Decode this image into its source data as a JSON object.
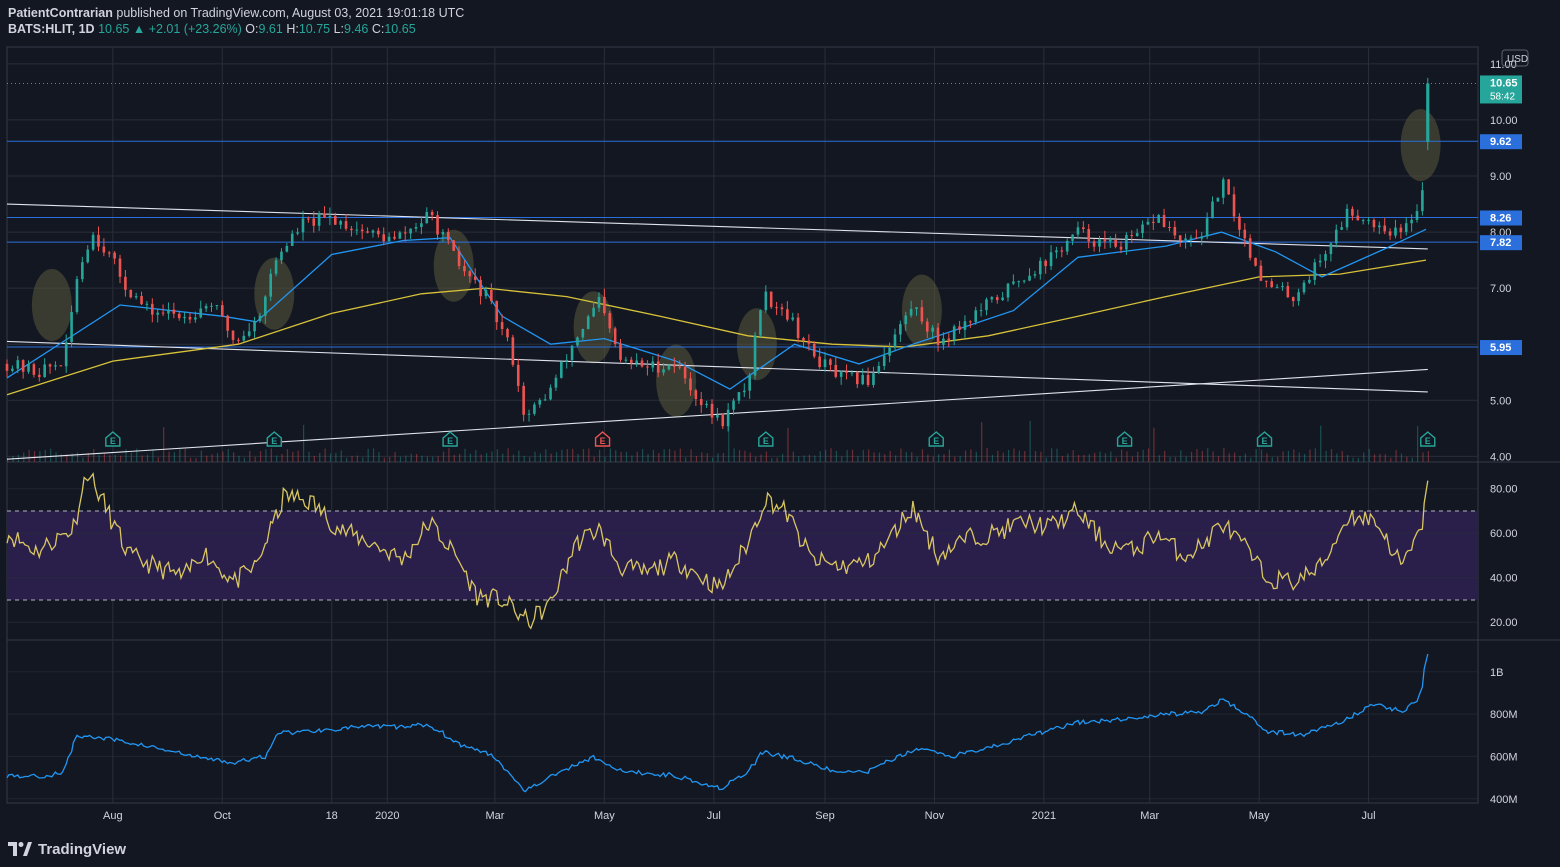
{
  "header": {
    "publisher": "PatientContrarian",
    "published_text": "published on TradingView.com, August 03, 2021 19:01:18 UTC",
    "symbol": "BATS:HLIT, 1D",
    "last": "10.65",
    "change": "+2.01 (+23.26%)",
    "o_label": "O:",
    "o": "9.61",
    "h_label": "H:",
    "h": "10.75",
    "l_label": "L:",
    "l": "9.46",
    "c_label": "C:",
    "c": "10.65"
  },
  "footer": {
    "brand": "TradingView"
  },
  "colors": {
    "background": "#131722",
    "grid": "#2a2e39",
    "up": "#26a69a",
    "down": "#ef5350",
    "ma_fast": "#2196f3",
    "ma_slow": "#d7c23a",
    "rsi": "#d9c663",
    "rsi_band": "#2a1f4a",
    "obv": "#2196f3",
    "level_line": "#2a6fdb",
    "trendline": "#e0e3eb",
    "highlight": "#5a5a3c"
  },
  "chart_data": [
    {
      "type": "candlestick",
      "title": "BATS:HLIT, 1D",
      "currency": "USD",
      "x_tick_labels": [
        "Aug",
        "Oct",
        "18",
        "2020",
        "Mar",
        "May",
        "Jul",
        "Sep",
        "Nov",
        "2021",
        "Mar",
        "May",
        "Jul"
      ],
      "x_tick_dates": [
        "2019-08-01",
        "2019-10-01",
        "2019-12-01",
        "2020-01-01",
        "2020-03-01",
        "2020-05-01",
        "2020-07-01",
        "2020-09-01",
        "2020-11-01",
        "2021-01-01",
        "2021-03-01",
        "2021-05-01",
        "2021-07-01"
      ],
      "x_range": [
        "2019-06-03",
        "2021-08-31"
      ],
      "y_ticks": [
        4.0,
        5.0,
        6.0,
        7.0,
        8.0,
        9.0,
        10.0,
        11.0
      ],
      "y_tick_labels": [
        "4.00",
        "5.00",
        "6.00",
        "7.00",
        "8.00",
        "9.00",
        "10.00",
        "11.00"
      ],
      "ylim": [
        3.9,
        11.3
      ],
      "horizontal_levels": [
        {
          "value": 9.62,
          "label": "9.62"
        },
        {
          "value": 8.26,
          "label": "8.26"
        },
        {
          "value": 7.82,
          "label": "7.82"
        },
        {
          "value": 5.95,
          "label": "5.95"
        }
      ],
      "last_price": {
        "value": 10.65,
        "label": "10.65",
        "countdown": "58:42"
      },
      "price_path": [
        [
          "2019-06-03",
          5.65
        ],
        [
          "2019-06-20",
          5.5
        ],
        [
          "2019-07-05",
          5.7
        ],
        [
          "2019-07-12",
          7.2
        ],
        [
          "2019-07-20",
          8.0
        ],
        [
          "2019-07-28",
          7.7
        ],
        [
          "2019-08-08",
          7.05
        ],
        [
          "2019-08-20",
          6.6
        ],
        [
          "2019-09-10",
          6.5
        ],
        [
          "2019-09-25",
          6.75
        ],
        [
          "2019-10-08",
          6.05
        ],
        [
          "2019-10-20",
          6.4
        ],
        [
          "2019-11-01",
          7.6
        ],
        [
          "2019-11-15",
          8.15
        ],
        [
          "2019-12-01",
          8.25
        ],
        [
          "2019-12-20",
          8.0
        ],
        [
          "2020-01-05",
          7.85
        ],
        [
          "2020-01-25",
          8.3
        ],
        [
          "2020-02-10",
          7.4
        ],
        [
          "2020-02-25",
          6.85
        ],
        [
          "2020-03-10",
          5.9
        ],
        [
          "2020-03-18",
          4.65
        ],
        [
          "2020-04-01",
          5.2
        ],
        [
          "2020-04-15",
          6.1
        ],
        [
          "2020-04-28",
          6.75
        ],
        [
          "2020-05-10",
          5.7
        ],
        [
          "2020-05-25",
          5.6
        ],
        [
          "2020-06-10",
          5.65
        ],
        [
          "2020-06-25",
          4.9
        ],
        [
          "2020-07-05",
          4.6
        ],
        [
          "2020-07-20",
          5.3
        ],
        [
          "2020-07-28",
          6.9
        ],
        [
          "2020-08-10",
          6.6
        ],
        [
          "2020-08-25",
          5.8
        ],
        [
          "2020-09-10",
          5.4
        ],
        [
          "2020-09-25",
          5.35
        ],
        [
          "2020-10-05",
          5.9
        ],
        [
          "2020-10-20",
          6.7
        ],
        [
          "2020-11-03",
          6.05
        ],
        [
          "2020-11-20",
          6.45
        ],
        [
          "2020-12-05",
          6.8
        ],
        [
          "2020-12-20",
          7.2
        ],
        [
          "2021-01-05",
          7.55
        ],
        [
          "2021-01-20",
          8.0
        ],
        [
          "2021-02-05",
          7.75
        ],
        [
          "2021-02-20",
          7.85
        ],
        [
          "2021-03-05",
          8.3
        ],
        [
          "2021-03-20",
          7.75
        ],
        [
          "2021-04-01",
          8.05
        ],
        [
          "2021-04-10",
          8.9
        ],
        [
          "2021-04-25",
          7.7
        ],
        [
          "2021-05-05",
          7.05
        ],
        [
          "2021-05-20",
          6.85
        ],
        [
          "2021-06-05",
          7.55
        ],
        [
          "2021-06-20",
          8.4
        ],
        [
          "2021-07-05",
          8.15
        ],
        [
          "2021-07-20",
          7.95
        ],
        [
          "2021-07-30",
          8.6
        ],
        [
          "2021-08-02",
          9.15
        ],
        [
          "2021-08-03",
          10.65
        ]
      ],
      "last_bar": {
        "date": "2021-08-03",
        "open": 9.61,
        "high": 10.75,
        "low": 9.46,
        "close": 10.65
      },
      "moving_averages": [
        {
          "path": [
            [
              "2019-06-03",
              5.4
            ],
            [
              "2019-08-05",
              6.7
            ],
            [
              "2019-10-01",
              6.5
            ],
            [
              "2019-10-20",
              6.4
            ],
            [
              "2019-12-01",
              7.6
            ],
            [
              "2020-01-10",
              7.85
            ],
            [
              "2020-02-05",
              7.9
            ],
            [
              "2020-03-05",
              6.5
            ],
            [
              "2020-04-01",
              6.0
            ],
            [
              "2020-05-01",
              6.1
            ],
            [
              "2020-06-10",
              5.7
            ],
            [
              "2020-07-10",
              5.2
            ],
            [
              "2020-08-15",
              6.0
            ],
            [
              "2020-09-20",
              5.65
            ],
            [
              "2020-10-20",
              6.0
            ],
            [
              "2020-12-15",
              6.6
            ],
            [
              "2021-01-20",
              7.55
            ],
            [
              "2021-03-10",
              7.75
            ],
            [
              "2021-04-10",
              8.0
            ],
            [
              "2021-05-10",
              7.65
            ],
            [
              "2021-06-05",
              7.2
            ],
            [
              "2021-07-10",
              7.7
            ],
            [
              "2021-08-02",
              8.05
            ]
          ]
        },
        {
          "path": [
            [
              "2019-06-03",
              5.1
            ],
            [
              "2019-08-01",
              5.7
            ],
            [
              "2019-10-10",
              6.0
            ],
            [
              "2019-12-01",
              6.55
            ],
            [
              "2020-01-20",
              6.9
            ],
            [
              "2020-02-25",
              7.0
            ],
            [
              "2020-04-10",
              6.85
            ],
            [
              "2020-06-01",
              6.5
            ],
            [
              "2020-07-20",
              6.15
            ],
            [
              "2020-09-05",
              6.0
            ],
            [
              "2020-10-15",
              5.95
            ],
            [
              "2020-12-01",
              6.15
            ],
            [
              "2021-01-20",
              6.5
            ],
            [
              "2021-03-10",
              6.85
            ],
            [
              "2021-05-01",
              7.2
            ],
            [
              "2021-06-15",
              7.25
            ],
            [
              "2021-08-02",
              7.5
            ]
          ]
        }
      ],
      "trendlines": [
        {
          "from": [
            "2019-06-03",
            8.5
          ],
          "to": [
            "2021-08-03",
            7.7
          ]
        },
        {
          "from": [
            "2019-06-03",
            6.05
          ],
          "to": [
            "2021-08-03",
            5.15
          ]
        },
        {
          "from": [
            "2019-06-03",
            3.95
          ],
          "to": [
            "2021-08-03",
            5.55
          ]
        }
      ],
      "highlights": [
        {
          "date": "2019-06-28",
          "price": 6.7
        },
        {
          "date": "2019-10-30",
          "price": 6.9
        },
        {
          "date": "2020-02-07",
          "price": 7.4
        },
        {
          "date": "2020-04-25",
          "price": 6.3
        },
        {
          "date": "2020-06-10",
          "price": 5.35
        },
        {
          "date": "2020-07-25",
          "price": 6.0
        },
        {
          "date": "2020-10-25",
          "price": 6.6
        },
        {
          "date": "2021-07-30",
          "price": 9.55
        }
      ],
      "earnings_markers": [
        {
          "date": "2019-08-01",
          "label": "E",
          "color": "#26a69a"
        },
        {
          "date": "2019-10-30",
          "label": "E",
          "color": "#26a69a"
        },
        {
          "date": "2020-02-05",
          "label": "E",
          "color": "#26a69a"
        },
        {
          "date": "2020-04-30",
          "label": "E",
          "color": "#ef5350"
        },
        {
          "date": "2020-07-30",
          "label": "E",
          "color": "#26a69a"
        },
        {
          "date": "2020-11-02",
          "label": "E",
          "color": "#26a69a"
        },
        {
          "date": "2021-02-15",
          "label": "E",
          "color": "#26a69a"
        },
        {
          "date": "2021-05-04",
          "label": "E",
          "color": "#26a69a"
        },
        {
          "date": "2021-08-03",
          "label": "E",
          "color": "#26a69a"
        }
      ]
    },
    {
      "type": "line",
      "y_ticks": [
        20,
        40,
        60,
        80
      ],
      "y_tick_labels": [
        "20.00",
        "40.00",
        "60.00",
        "80.00"
      ],
      "ylim": [
        12,
        92
      ],
      "band": [
        30,
        70
      ],
      "path": [
        [
          "2019-06-03",
          60
        ],
        [
          "2019-06-20",
          52
        ],
        [
          "2019-07-10",
          62
        ],
        [
          "2019-07-18",
          88
        ],
        [
          "2019-07-28",
          72
        ],
        [
          "2019-08-10",
          50
        ],
        [
          "2019-08-25",
          45
        ],
        [
          "2019-09-10",
          40
        ],
        [
          "2019-09-20",
          52
        ],
        [
          "2019-10-08",
          38
        ],
        [
          "2019-10-20",
          45
        ],
        [
          "2019-11-05",
          77
        ],
        [
          "2019-11-20",
          74
        ],
        [
          "2019-12-05",
          62
        ],
        [
          "2019-12-25",
          55
        ],
        [
          "2020-01-10",
          48
        ],
        [
          "2020-01-25",
          65
        ],
        [
          "2020-02-10",
          48
        ],
        [
          "2020-02-20",
          32
        ],
        [
          "2020-03-05",
          30
        ],
        [
          "2020-03-20",
          20
        ],
        [
          "2020-04-01",
          28
        ],
        [
          "2020-04-15",
          55
        ],
        [
          "2020-04-28",
          62
        ],
        [
          "2020-05-10",
          45
        ],
        [
          "2020-05-25",
          42
        ],
        [
          "2020-06-10",
          48
        ],
        [
          "2020-06-25",
          40
        ],
        [
          "2020-07-05",
          35
        ],
        [
          "2020-07-20",
          55
        ],
        [
          "2020-07-30",
          76
        ],
        [
          "2020-08-10",
          70
        ],
        [
          "2020-08-25",
          48
        ],
        [
          "2020-09-10",
          45
        ],
        [
          "2020-09-25",
          47
        ],
        [
          "2020-10-05",
          55
        ],
        [
          "2020-10-20",
          72
        ],
        [
          "2020-11-03",
          50
        ],
        [
          "2020-11-20",
          58
        ],
        [
          "2020-12-05",
          60
        ],
        [
          "2020-12-20",
          65
        ],
        [
          "2021-01-05",
          63
        ],
        [
          "2021-01-20",
          70
        ],
        [
          "2021-02-05",
          55
        ],
        [
          "2021-02-20",
          52
        ],
        [
          "2021-03-05",
          60
        ],
        [
          "2021-03-20",
          50
        ],
        [
          "2021-04-01",
          55
        ],
        [
          "2021-04-10",
          65
        ],
        [
          "2021-04-25",
          52
        ],
        [
          "2021-05-05",
          40
        ],
        [
          "2021-05-20",
          38
        ],
        [
          "2021-06-05",
          45
        ],
        [
          "2021-06-20",
          68
        ],
        [
          "2021-07-05",
          66
        ],
        [
          "2021-07-20",
          45
        ],
        [
          "2021-07-30",
          60
        ],
        [
          "2021-08-03",
          80
        ]
      ]
    },
    {
      "type": "line",
      "y_ticks": [
        400000000,
        600000000,
        800000000,
        1000000000
      ],
      "y_tick_labels": [
        "400M",
        "600M",
        "800M",
        "1B"
      ],
      "ylim": [
        380000000,
        1150000000
      ],
      "path": [
        [
          "2019-06-03",
          510000000
        ],
        [
          "2019-06-25",
          505000000
        ],
        [
          "2019-07-05",
          530000000
        ],
        [
          "2019-07-12",
          700000000
        ],
        [
          "2019-08-01",
          680000000
        ],
        [
          "2019-08-20",
          650000000
        ],
        [
          "2019-09-15",
          600000000
        ],
        [
          "2019-10-08",
          570000000
        ],
        [
          "2019-10-25",
          600000000
        ],
        [
          "2019-11-01",
          710000000
        ],
        [
          "2019-11-20",
          720000000
        ],
        [
          "2019-12-15",
          740000000
        ],
        [
          "2020-01-10",
          740000000
        ],
        [
          "2020-01-25",
          750000000
        ],
        [
          "2020-02-10",
          660000000
        ],
        [
          "2020-03-01",
          600000000
        ],
        [
          "2020-03-18",
          440000000
        ],
        [
          "2020-04-05",
          520000000
        ],
        [
          "2020-04-25",
          600000000
        ],
        [
          "2020-05-10",
          530000000
        ],
        [
          "2020-06-10",
          510000000
        ],
        [
          "2020-07-05",
          450000000
        ],
        [
          "2020-07-20",
          520000000
        ],
        [
          "2020-07-28",
          620000000
        ],
        [
          "2020-08-15",
          590000000
        ],
        [
          "2020-09-10",
          520000000
        ],
        [
          "2020-09-25",
          530000000
        ],
        [
          "2020-10-10",
          590000000
        ],
        [
          "2020-10-25",
          640000000
        ],
        [
          "2020-11-10",
          600000000
        ],
        [
          "2020-12-05",
          650000000
        ],
        [
          "2020-12-25",
          700000000
        ],
        [
          "2021-01-20",
          760000000
        ],
        [
          "2021-02-20",
          780000000
        ],
        [
          "2021-03-10",
          800000000
        ],
        [
          "2021-04-01",
          810000000
        ],
        [
          "2021-04-10",
          870000000
        ],
        [
          "2021-04-25",
          800000000
        ],
        [
          "2021-05-05",
          720000000
        ],
        [
          "2021-05-25",
          700000000
        ],
        [
          "2021-06-15",
          760000000
        ],
        [
          "2021-07-05",
          850000000
        ],
        [
          "2021-07-20",
          810000000
        ],
        [
          "2021-07-30",
          880000000
        ],
        [
          "2021-08-03",
          1090000000
        ]
      ]
    }
  ]
}
